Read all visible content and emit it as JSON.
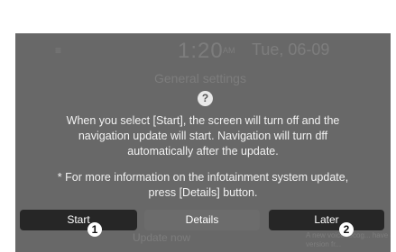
{
  "status_bar": {
    "menu_icon": "menu-icon",
    "time": "1:20",
    "ampm": "AM",
    "date": "Tue, 06-09"
  },
  "background": {
    "title": "General settings",
    "update_now": "Update now",
    "notice": "A new voice recog... have a version fr..."
  },
  "dialog": {
    "icon": "question-icon",
    "message_lines": [
      "When you select [Start], the screen will turn off and the",
      "navigation update will start. Navigation will turn dff",
      "automatically after the update."
    ],
    "info_lines": [
      "* For more information on the infotainment system update,",
      "press [Details] button."
    ]
  },
  "buttons": {
    "start": "Start",
    "details": "Details",
    "later": "Later"
  },
  "callouts": {
    "one": "1",
    "two": "2"
  },
  "colors": {
    "screen_bg": "#7b7b7b",
    "button_dark": "#262626",
    "button_mid": "#6c6c6c",
    "text_light": "#f2f2f2"
  }
}
